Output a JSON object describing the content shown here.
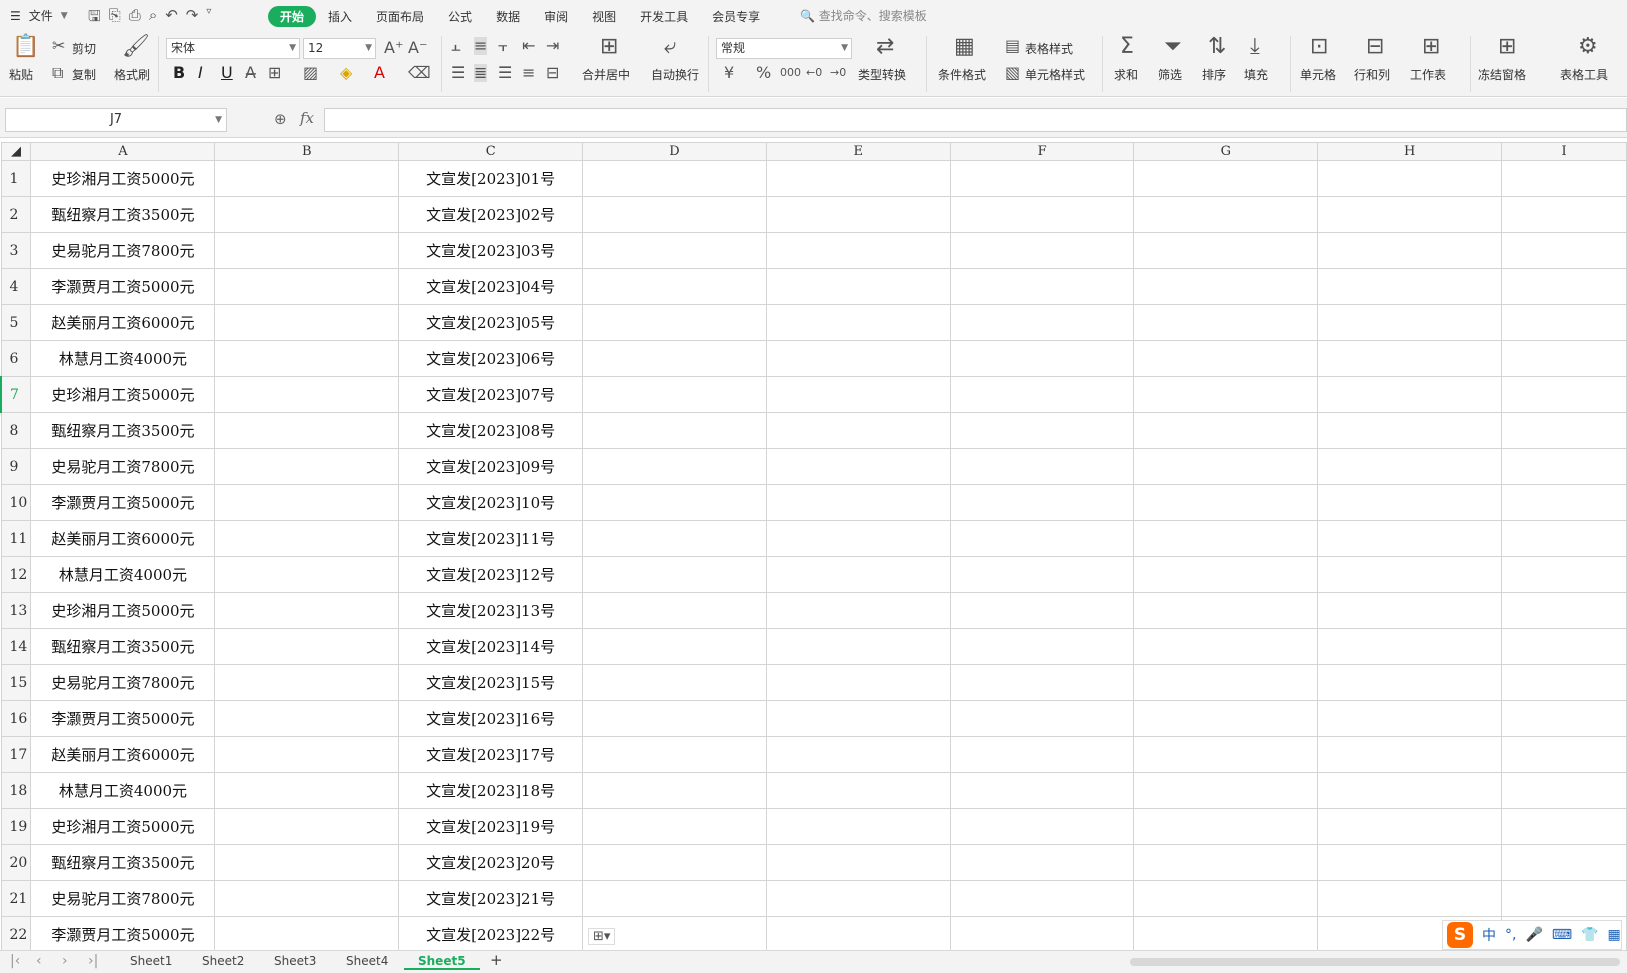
{
  "menubar": {
    "file_label": "文件",
    "tabs": [
      "开始",
      "插入",
      "页面布局",
      "公式",
      "数据",
      "审阅",
      "视图",
      "开发工具",
      "会员专享"
    ],
    "search_placeholder": "查找命令、搜索模板"
  },
  "ribbon": {
    "paste": "粘贴",
    "cut": "剪切",
    "copy": "复制",
    "format_painter": "格式刷",
    "font_name": "宋体",
    "font_size": "12",
    "merge_center": "合并居中",
    "wrap_text": "自动换行",
    "number_format": "常规",
    "type_convert": "类型转换",
    "conditional_format": "条件格式",
    "table_style": "表格样式",
    "cell_style": "单元格样式",
    "sum": "求和",
    "filter": "筛选",
    "sort": "排序",
    "fill": "填充",
    "cell": "单元格",
    "row_col": "行和列",
    "worksheet": "工作表",
    "freeze": "冻结窗格",
    "table_tools": "表格工具"
  },
  "formula": {
    "cell_ref": "J7",
    "fx": "fx",
    "content": ""
  },
  "sheet": {
    "columns": [
      "A",
      "B",
      "C",
      "D",
      "E",
      "F",
      "G",
      "H",
      "I"
    ],
    "selected_row": 7,
    "rows": [
      {
        "n": "1",
        "a": "史珍湘月工资5000元",
        "c": "文宣发[2023]01号"
      },
      {
        "n": "2",
        "a": "甄纽察月工资3500元",
        "c": "文宣发[2023]02号"
      },
      {
        "n": "3",
        "a": "史易驼月工资7800元",
        "c": "文宣发[2023]03号"
      },
      {
        "n": "4",
        "a": "李灏贾月工资5000元",
        "c": "文宣发[2023]04号"
      },
      {
        "n": "5",
        "a": "赵美丽月工资6000元",
        "c": "文宣发[2023]05号"
      },
      {
        "n": "6",
        "a": "林慧月工资4000元",
        "c": "文宣发[2023]06号"
      },
      {
        "n": "7",
        "a": "史珍湘月工资5000元",
        "c": "文宣发[2023]07号"
      },
      {
        "n": "8",
        "a": "甄纽察月工资3500元",
        "c": "文宣发[2023]08号"
      },
      {
        "n": "9",
        "a": "史易驼月工资7800元",
        "c": "文宣发[2023]09号"
      },
      {
        "n": "10",
        "a": "李灏贾月工资5000元",
        "c": "文宣发[2023]10号"
      },
      {
        "n": "11",
        "a": "赵美丽月工资6000元",
        "c": "文宣发[2023]11号"
      },
      {
        "n": "12",
        "a": "林慧月工资4000元",
        "c": "文宣发[2023]12号"
      },
      {
        "n": "13",
        "a": "史珍湘月工资5000元",
        "c": "文宣发[2023]13号"
      },
      {
        "n": "14",
        "a": "甄纽察月工资3500元",
        "c": "文宣发[2023]14号"
      },
      {
        "n": "15",
        "a": "史易驼月工资7800元",
        "c": "文宣发[2023]15号"
      },
      {
        "n": "16",
        "a": "李灏贾月工资5000元",
        "c": "文宣发[2023]16号"
      },
      {
        "n": "17",
        "a": "赵美丽月工资6000元",
        "c": "文宣发[2023]17号"
      },
      {
        "n": "18",
        "a": "林慧月工资4000元",
        "c": "文宣发[2023]18号"
      },
      {
        "n": "19",
        "a": "史珍湘月工资5000元",
        "c": "文宣发[2023]19号"
      },
      {
        "n": "20",
        "a": "甄纽察月工资3500元",
        "c": "文宣发[2023]20号"
      },
      {
        "n": "21",
        "a": "史易驼月工资7800元",
        "c": "文宣发[2023]21号"
      },
      {
        "n": "22",
        "a": "李灏贾月工资5000元",
        "c": "文宣发[2023]22号"
      }
    ]
  },
  "sheet_tabs": {
    "tabs": [
      "Sheet1",
      "Sheet2",
      "Sheet3",
      "Sheet4",
      "Sheet5"
    ],
    "active": "Sheet5",
    "add": "+"
  },
  "ime": {
    "logo": "S",
    "mode": "中",
    "punct": "°,"
  },
  "colors": {
    "accent": "#1aad5e",
    "grid": "#d4d4d4",
    "chrome": "#f3f3f3"
  }
}
